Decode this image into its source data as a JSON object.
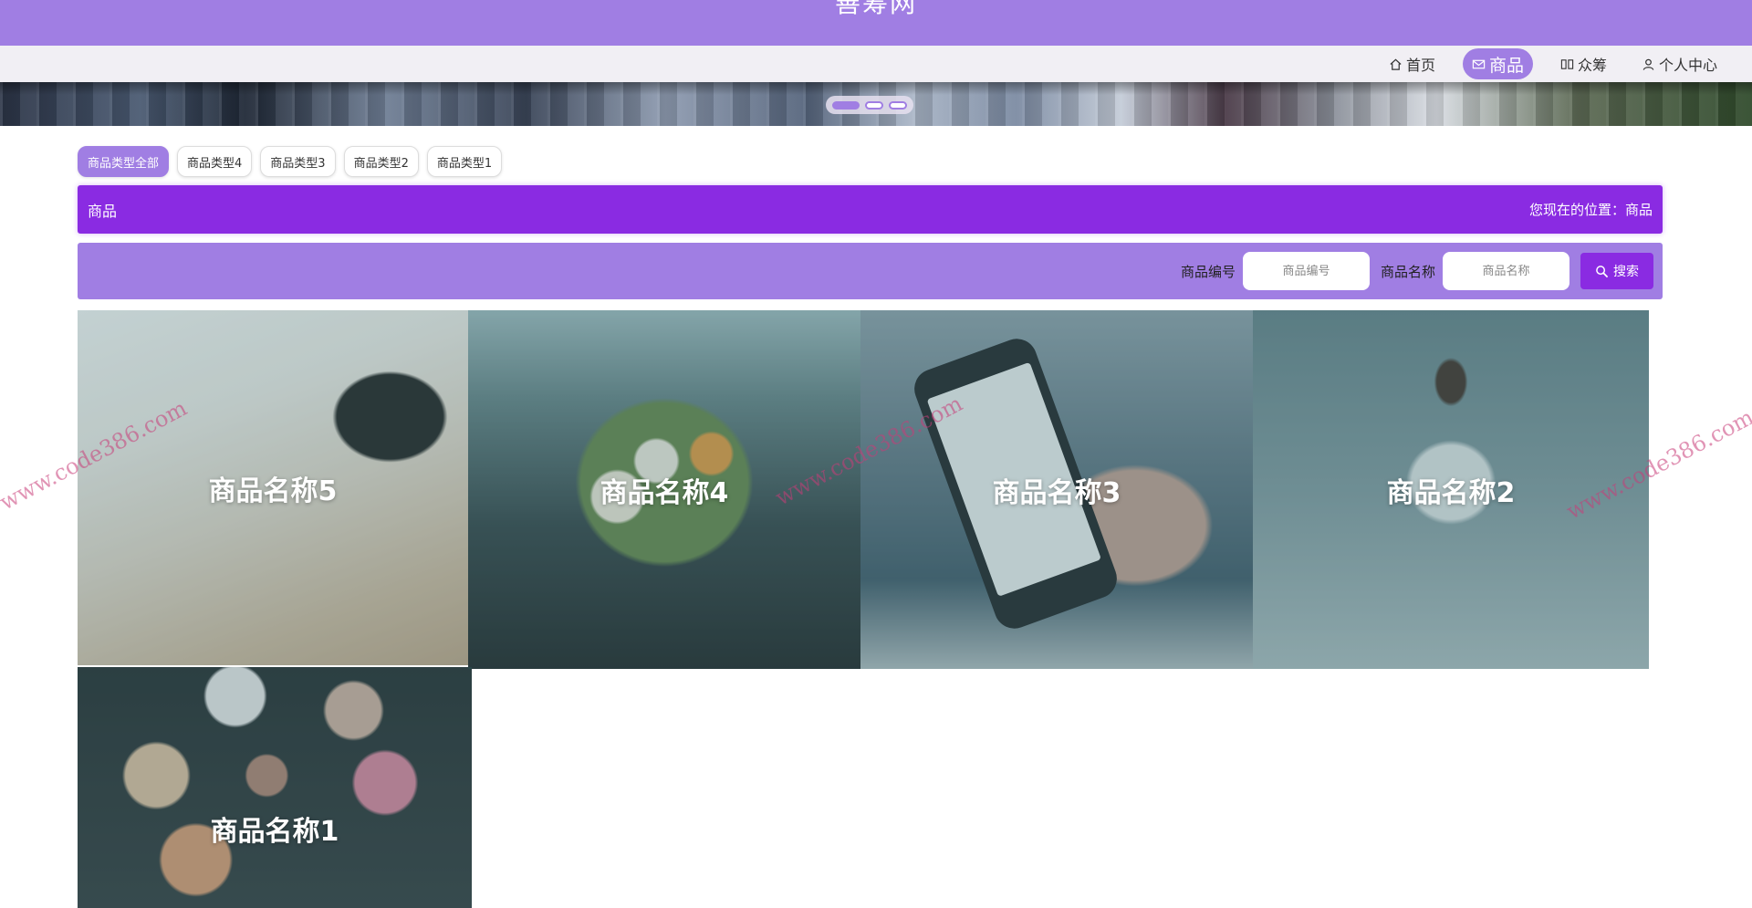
{
  "site": {
    "title": "善筹网"
  },
  "nav": {
    "items": [
      {
        "label": "首页",
        "icon": "home-icon"
      },
      {
        "label": "商品",
        "icon": "mail-icon",
        "active": true
      },
      {
        "label": "众筹",
        "icon": "crowdfund-icon"
      },
      {
        "label": "个人中心",
        "icon": "user-icon"
      }
    ]
  },
  "banner": {
    "slides": 3,
    "active_slide": 1
  },
  "category_tabs": [
    {
      "label": "商品类型全部",
      "active": true
    },
    {
      "label": "商品类型4"
    },
    {
      "label": "商品类型3"
    },
    {
      "label": "商品类型2"
    },
    {
      "label": "商品类型1"
    }
  ],
  "section": {
    "title": "商品",
    "breadcrumb": "您现在的位置：商品"
  },
  "search": {
    "code_label": "商品编号",
    "code_placeholder": "商品编号",
    "name_label": "商品名称",
    "name_placeholder": "商品名称",
    "button_label": "搜索"
  },
  "products": [
    {
      "name": "商品名称5"
    },
    {
      "name": "商品名称4"
    },
    {
      "name": "商品名称3"
    },
    {
      "name": "商品名称2"
    },
    {
      "name": "商品名称1"
    }
  ],
  "watermark": "www.code386.com",
  "colors": {
    "header": "#a07ee3",
    "accent": "#8a2be2",
    "navbar": "#f1eff4"
  }
}
